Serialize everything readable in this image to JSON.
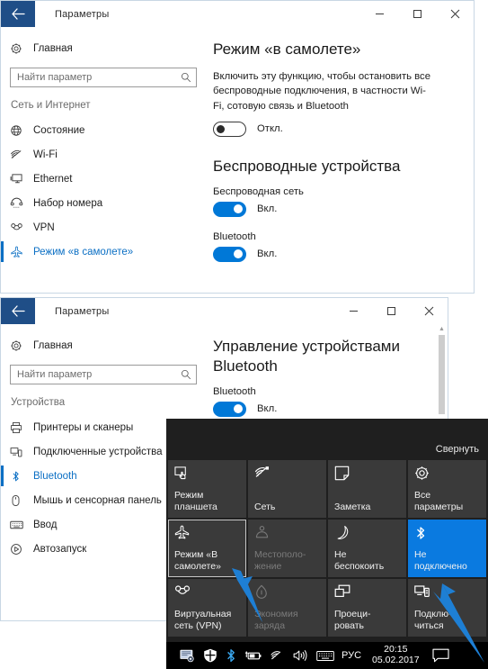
{
  "windows": [
    {
      "id": "network-settings",
      "titlebar": {
        "title": "Параметры",
        "back_icon": "back-arrow-icon",
        "minimize_label": "—",
        "maximize_label": "□",
        "close_label": "✕"
      },
      "sidebar": {
        "home": {
          "label": "Главная",
          "icon": "gear-icon"
        },
        "search": {
          "placeholder": "Найти параметр",
          "value": "",
          "icon": "search-icon"
        },
        "group_header": "Сеть и Интернет",
        "items": [
          {
            "label": "Состояние",
            "icon": "globe-icon",
            "selected": false
          },
          {
            "label": "Wi-Fi",
            "icon": "wifi-icon",
            "selected": false
          },
          {
            "label": "Ethernet",
            "icon": "ethernet-icon",
            "selected": false
          },
          {
            "label": "Набор номера",
            "icon": "dialup-phone-icon",
            "selected": false
          },
          {
            "label": "VPN",
            "icon": "vpn-icon",
            "selected": false
          },
          {
            "label": "Режим «в самолете»",
            "icon": "airplane-icon",
            "selected": true
          }
        ]
      },
      "content": {
        "heading": "Режим «в самолете»",
        "description": "Включить эту функцию, чтобы остановить все беспроводные подключения, в частности Wi-Fi, сотовую связь и Bluetooth",
        "airplane_toggle": {
          "state": "off",
          "label": "Откл."
        },
        "heading2": "Беспроводные устройства",
        "sections": [
          {
            "label": "Беспроводная сеть",
            "toggle_state": "on",
            "toggle_label": "Вкл."
          },
          {
            "label": "Bluetooth",
            "toggle_state": "on",
            "toggle_label": "Вкл."
          }
        ]
      }
    },
    {
      "id": "bluetooth-settings",
      "titlebar": {
        "title": "Параметры",
        "back_icon": "back-arrow-icon",
        "minimize_label": "—",
        "maximize_label": "□",
        "close_label": "✕"
      },
      "sidebar": {
        "home": {
          "label": "Главная",
          "icon": "gear-icon"
        },
        "search": {
          "placeholder": "Найти параметр",
          "value": "",
          "icon": "search-icon"
        },
        "group_header": "Устройства",
        "items": [
          {
            "label": "Принтеры и сканеры",
            "icon": "printer-icon",
            "selected": false
          },
          {
            "label": "Подключенные устройства",
            "icon": "devices-icon",
            "selected": false
          },
          {
            "label": "Bluetooth",
            "icon": "bluetooth-icon",
            "selected": true
          },
          {
            "label": "Мышь и сенсорная панель",
            "icon": "mouse-icon",
            "selected": false
          },
          {
            "label": "Ввод",
            "icon": "keyboard-icon",
            "selected": false
          },
          {
            "label": "Автозапуск",
            "icon": "autoplay-icon",
            "selected": false
          }
        ]
      },
      "content": {
        "heading": "Управление устройствами Bluetooth",
        "sections": [
          {
            "label": "Bluetooth",
            "toggle_state": "on",
            "toggle_label": "Вкл."
          }
        ]
      }
    }
  ],
  "action_center": {
    "collapse_label": "Свернуть",
    "tiles": [
      {
        "label": "Режим\nпланшета",
        "icon": "tablet-mode-icon",
        "state": "normal"
      },
      {
        "label": "Сеть",
        "icon": "network-wifi-icon",
        "state": "normal"
      },
      {
        "label": "Заметка",
        "icon": "note-icon",
        "state": "normal"
      },
      {
        "label": "Все\nпараметры",
        "icon": "gear-icon",
        "state": "normal"
      },
      {
        "label": "Режим «В\nсамолете»",
        "icon": "airplane-icon",
        "state": "focused"
      },
      {
        "label": "Местополо-\nжение",
        "icon": "location-icon",
        "state": "disabled"
      },
      {
        "label": "Не\nбеспокоить",
        "icon": "moon-icon",
        "state": "normal"
      },
      {
        "label": "Не\nподключено",
        "icon": "bluetooth-icon",
        "state": "accent"
      },
      {
        "label": "Виртуальная\nсеть (VPN)",
        "icon": "vpn-icon",
        "state": "normal"
      },
      {
        "label": "Экономия\nзаряда",
        "icon": "battery-saver-icon",
        "state": "disabled"
      },
      {
        "label": "Проеци-\nровать",
        "icon": "project-icon",
        "state": "normal"
      },
      {
        "label": "Подклю-\nчиться",
        "icon": "connect-icon",
        "state": "normal"
      }
    ]
  },
  "taskbar": {
    "tray_icons": [
      "tray-settings-icon",
      "windows-defender-icon",
      "bluetooth-icon",
      "battery-icon",
      "wifi-icon",
      "volume-icon",
      "keyboard-layout-icon"
    ],
    "language": "РУС",
    "time": "20:15",
    "date": "05.02.2017",
    "action_center_icon": "action-center-icon"
  },
  "colors": {
    "accent": "#0078d7",
    "titlebar_back": "#1f4e87",
    "action_center_bg": "#1f1f1f",
    "tile_bg": "#3a3a3a",
    "tile_accent": "#0a7ae0",
    "annotation_arrow": "#1e7fd4",
    "link": "#0b6fc4"
  }
}
